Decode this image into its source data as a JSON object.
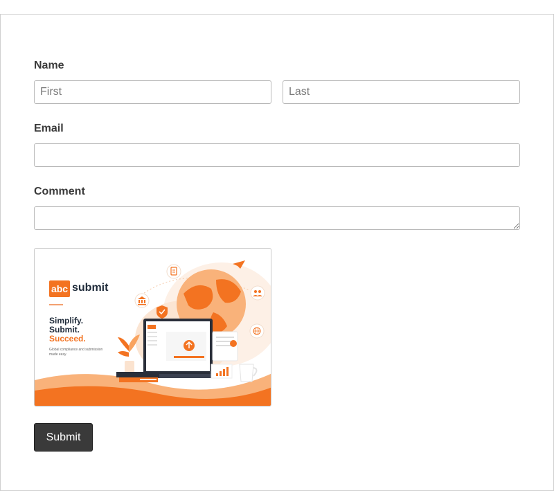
{
  "form": {
    "name_label": "Name",
    "first_placeholder": "First",
    "last_placeholder": "Last",
    "email_label": "Email",
    "email_value": "",
    "comment_label": "Comment",
    "comment_value": "",
    "submit_label": "Submit"
  },
  "banner": {
    "logo_box_text": "abc",
    "logo_word": "submit",
    "tagline": [
      "Simplify.",
      "Submit.",
      "Succeed."
    ],
    "fine_print": "Global compliance and submission made easy.",
    "accent_color": "#f37321",
    "icons": [
      "document-icon",
      "paper-plane-icon",
      "bank-icon",
      "shield-check-icon",
      "people-icon",
      "globe-icon",
      "upload-icon",
      "bar-chart-icon",
      "plant-icon",
      "coffee-cup-icon",
      "laptop-icon"
    ]
  }
}
